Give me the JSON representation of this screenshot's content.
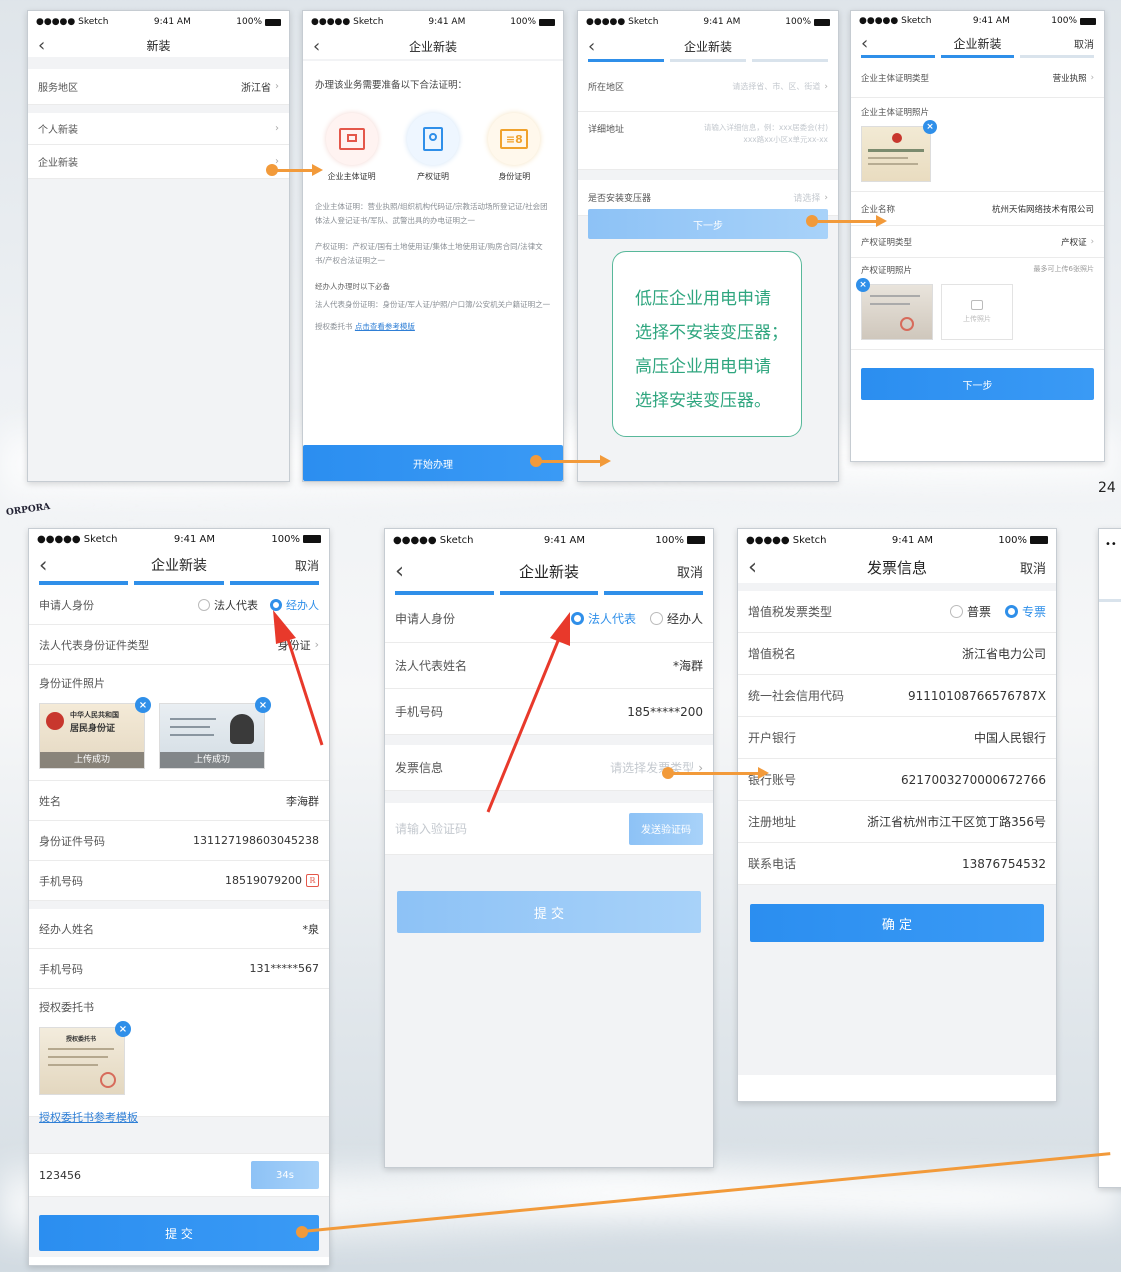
{
  "status": {
    "carrier": "●●●●● Sketch",
    "time": "9:41 AM",
    "battery": "100%"
  },
  "s1": {
    "title": "新装",
    "rows": [
      {
        "label": "服务地区",
        "value": "浙江省"
      },
      {
        "label": "个人新装",
        "value": ""
      },
      {
        "label": "企业新装",
        "value": ""
      }
    ]
  },
  "s2": {
    "title": "企业新装",
    "intro": "办理该业务需要准备以下合法证明：",
    "icons": [
      {
        "label": "企业主体证明"
      },
      {
        "label": "产权证明"
      },
      {
        "label": "身份证明"
      }
    ],
    "p1": "企业主体证明：营业执照/组织机构代码证/宗教活动场所登记证/社会团体法人登记证书/军队、武警出具的办电证明之一",
    "p2": "产权证明：产权证/国有土地使用证/集体土地使用证/购房合同/法律文书/产权合法证明之一",
    "p3": "经办人办理时以下必备",
    "p4": "法人代表身份证明：身份证/军人证/护照/户口簿/公安机关户籍证明之一",
    "p5a": "授权委托书",
    "p5b": "点击查看参考模版",
    "button": "开始办理"
  },
  "s3": {
    "title": "企业新装",
    "r1": {
      "label": "所在地区",
      "ph": "请选择省、市、区、街道"
    },
    "r2": {
      "label": "详细地址",
      "ph1": "请输入详细信息，例：xxx居委会(村)",
      "ph2": "xxx路xx小区x单元xx-xx"
    },
    "r3": {
      "label": "是否安装变压器",
      "ph": "请选择"
    },
    "button": "下一步",
    "note": [
      "低压企业用电申请",
      "选择不安装变压器；",
      "高压企业用电申请",
      "选择安装变压器。"
    ]
  },
  "s4": {
    "title": "企业新装",
    "cancel": "取消",
    "r1": {
      "label": "企业主体证明类型",
      "value": "营业执照"
    },
    "r2": {
      "label": "企业主体证明照片"
    },
    "r3": {
      "label": "企业名称",
      "value": "杭州天佑网络技术有限公司"
    },
    "r4": {
      "label": "产权证明类型",
      "value": "产权证"
    },
    "r5": {
      "label": "产权证明照片",
      "hint": "最多可上传6张照片"
    },
    "upload": "上传照片",
    "button": "下一步"
  },
  "page_num": "24",
  "logo": "ORPORA",
  "s5": {
    "title": "企业新装",
    "cancel": "取消",
    "r1": {
      "label": "申请人身份",
      "opt1": "法人代表",
      "opt2": "经办人"
    },
    "r2": {
      "label": "法人代表身份证件类型",
      "value": "身份证"
    },
    "r3": {
      "label": "身份证件照片",
      "uploaded": "上传成功",
      "idcard1": "中华人民共和国",
      "idcard2": "居民身份证"
    },
    "r4": {
      "label": "姓名",
      "value": "李海群"
    },
    "r5": {
      "label": "身份证件号码",
      "value": "131127198603045238"
    },
    "r6": {
      "label": "手机号码",
      "value": "18519079200"
    },
    "r7": {
      "label": "经办人姓名",
      "value": "*泉"
    },
    "r8": {
      "label": "手机号码",
      "value": "131*****567"
    },
    "r9": {
      "label": "授权委托书",
      "doc": "授权委托书"
    },
    "link": "授权委托书参考模板",
    "code": "123456",
    "timer": "34s",
    "button": "提 交"
  },
  "s6": {
    "title": "企业新装",
    "cancel": "取消",
    "r1": {
      "label": "申请人身份",
      "opt1": "法人代表",
      "opt2": "经办人"
    },
    "r2": {
      "label": "法人代表姓名",
      "value": "*海群"
    },
    "r3": {
      "label": "手机号码",
      "value": "185*****200"
    },
    "r4": {
      "label": "发票信息",
      "ph": "请选择发票类型"
    },
    "code_ph": "请输入验证码",
    "send": "发送验证码",
    "button": "提 交"
  },
  "s7": {
    "title": "发票信息",
    "cancel": "取消",
    "r1": {
      "label": "增值税发票类型",
      "opt1": "普票",
      "opt2": "专票"
    },
    "r2": {
      "label": "增值税名",
      "value": "浙江省电力公司"
    },
    "r3": {
      "label": "统一社会信用代码",
      "value": "91110108766576787X"
    },
    "r4": {
      "label": "开户银行",
      "value": "中国人民银行"
    },
    "r5": {
      "label": "银行账号",
      "value": "6217003270000672766"
    },
    "r6": {
      "label": "注册地址",
      "value": "浙江省杭州市江干区笕丁路356号"
    },
    "r7": {
      "label": "联系电话",
      "value": "13876754532"
    },
    "button": "确 定"
  },
  "colors": {
    "primary": "#2f8fe9",
    "arrow_orange": "#f29a3a",
    "red_arrow": "#e8392b",
    "note_green": "#2fa67f"
  }
}
